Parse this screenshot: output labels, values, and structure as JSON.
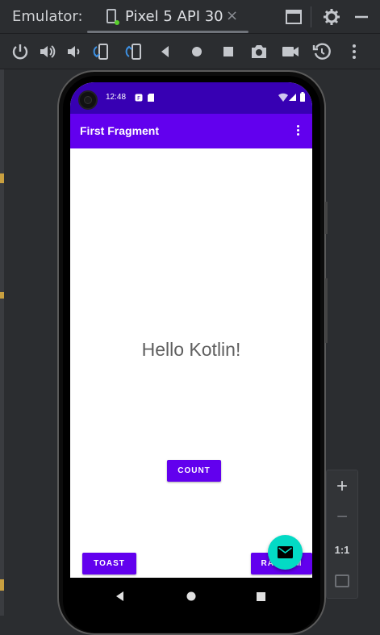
{
  "window": {
    "title_label": "Emulator:",
    "tab_label": "Pixel 5 API 30",
    "tab_close": "×"
  },
  "toolbar": {
    "items": [
      "power-icon",
      "volume-up-icon",
      "volume-down-icon",
      "rotate-left-icon",
      "rotate-right-icon",
      "back-icon",
      "home-icon",
      "overview-icon",
      "camera-icon",
      "video-icon",
      "snapshot-icon",
      "more-icon"
    ]
  },
  "device": {
    "status_time": "12:48",
    "app_title": "First Fragment",
    "main_text": "Hello Kotlin!",
    "buttons": {
      "count": "COUNT",
      "toast": "TOAST",
      "random": "RANDOM"
    }
  },
  "zoom": {
    "plus": "+",
    "minus": "−",
    "ratio": "1:1"
  },
  "colors": {
    "status_bar": "#3700b3",
    "app_bar": "#6200ee",
    "button": "#6200ee",
    "fab": "#03dac5",
    "ide_background": "#2b2d30"
  }
}
